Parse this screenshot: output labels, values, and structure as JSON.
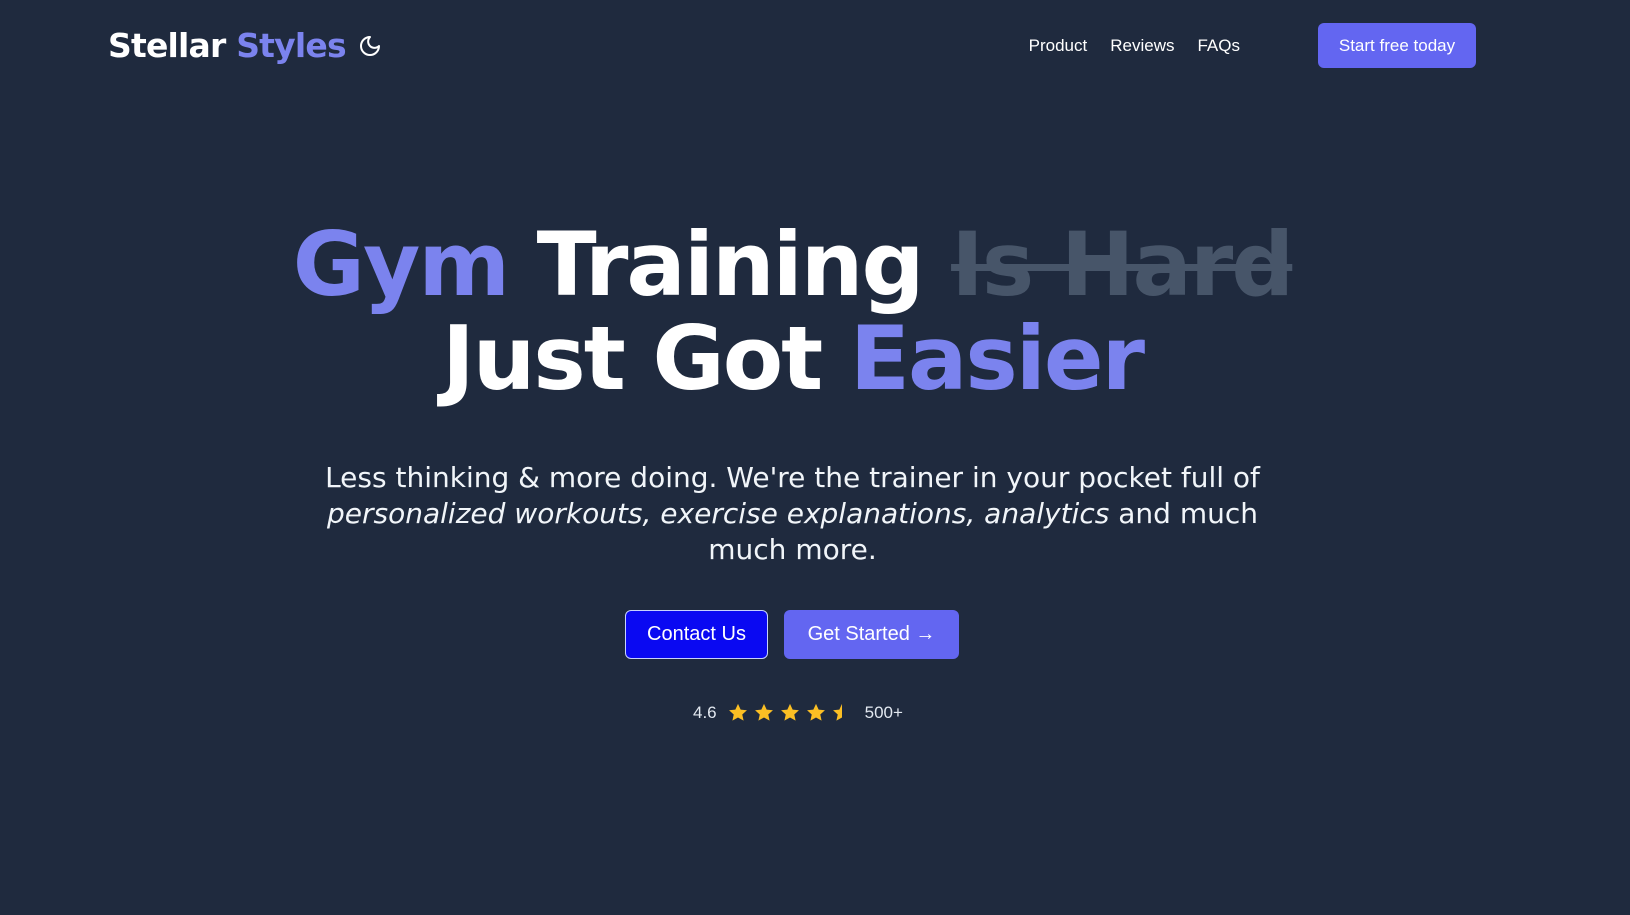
{
  "brand": {
    "name_part1": "Stellar",
    "name_part2": "Styles"
  },
  "nav": {
    "theme_toggle_icon": "moon-icon",
    "links": [
      {
        "label": "Product"
      },
      {
        "label": "Reviews"
      },
      {
        "label": "FAQs"
      }
    ],
    "cta_label": "Start free today"
  },
  "hero": {
    "title_word1": "Gym",
    "title_word2": "Training",
    "title_struck": "Is Hard",
    "title_line2_prefix": "Just Got",
    "title_line2_highlight": "Easier",
    "subtitle_part1": "Less thinking & more doing. We're the trainer in your pocket full of",
    "subtitle_italic": "personalized workouts, exercise explanations, analytics",
    "subtitle_part2": "and much much more.",
    "contact_label": "Contact Us",
    "get_started_label": "Get Started →"
  },
  "rating": {
    "score": "4.6",
    "stars_value": 4.5,
    "stars_max": 5,
    "count": "500+"
  },
  "colors": {
    "background": "#1f2a3e",
    "accent": "#7b83ee",
    "primary_button": "#6366f1",
    "contact_button": "#0a09f2",
    "strike_text": "#475569",
    "star": "#fbbf24"
  }
}
